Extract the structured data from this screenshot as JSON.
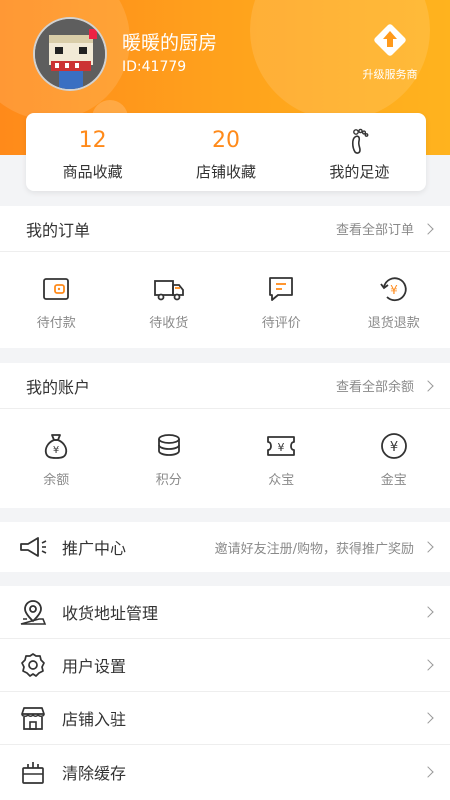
{
  "profile": {
    "username": "暖暖的厨房",
    "user_id": "ID:41779",
    "upgrade_label": "升级服务商"
  },
  "stats": [
    {
      "value": "12",
      "label": "商品收藏"
    },
    {
      "value": "20",
      "label": "店铺收藏"
    },
    {
      "value": "",
      "label": "我的足迹"
    }
  ],
  "orders": {
    "title": "我的订单",
    "link": "查看全部订单",
    "items": [
      {
        "label": "待付款",
        "icon": "wallet-icon"
      },
      {
        "label": "待收货",
        "icon": "truck-icon"
      },
      {
        "label": "待评价",
        "icon": "comment-icon"
      },
      {
        "label": "退货退款",
        "icon": "refund-icon"
      }
    ]
  },
  "account": {
    "title": "我的账户",
    "link": "查看全部余额",
    "items": [
      {
        "label": "余额",
        "icon": "money-bag-icon"
      },
      {
        "label": "积分",
        "icon": "coins-icon"
      },
      {
        "label": "众宝",
        "icon": "ticket-icon"
      },
      {
        "label": "金宝",
        "icon": "yen-coin-icon"
      }
    ]
  },
  "promo": {
    "label": "推广中心",
    "hint": "邀请好友注册/购物，获得推广奖励"
  },
  "menu": [
    {
      "label": "收货地址管理",
      "icon": "location-icon"
    },
    {
      "label": "用户设置",
      "icon": "settings-icon"
    },
    {
      "label": "店铺入驻",
      "icon": "store-icon"
    },
    {
      "label": "清除缓存",
      "icon": "trash-icon"
    }
  ],
  "colors": {
    "accent": "#ff8a1a",
    "text": "#333333",
    "muted": "#8a8a8a"
  }
}
